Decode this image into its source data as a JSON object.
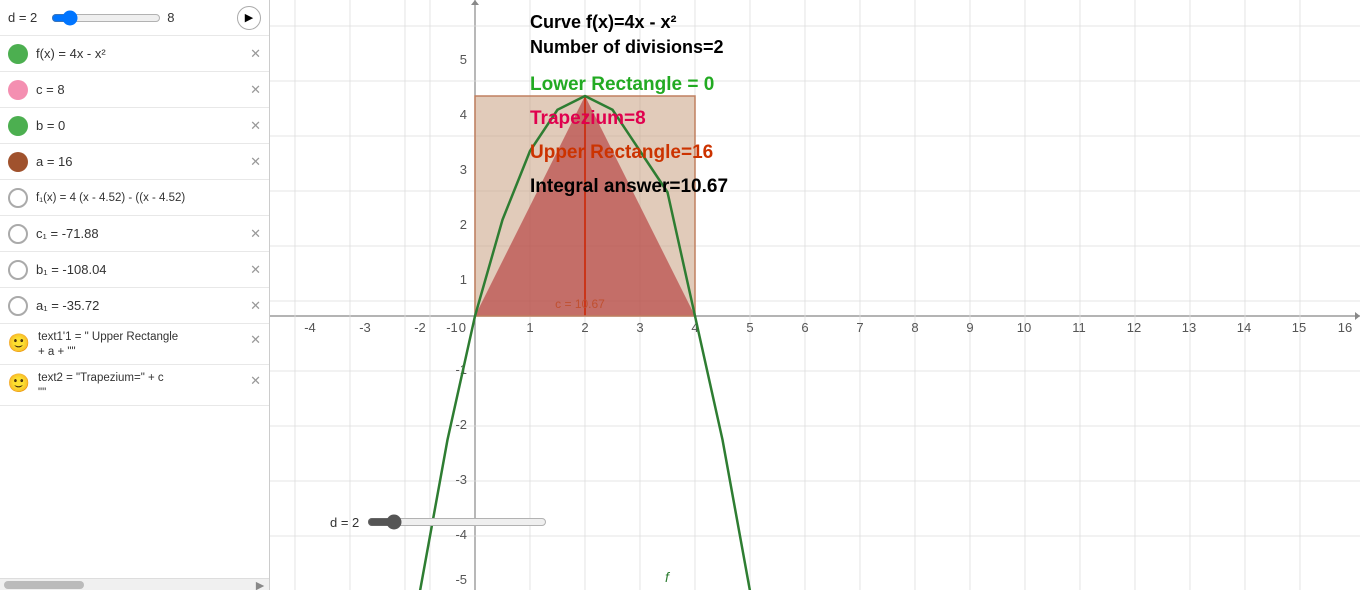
{
  "left_panel": {
    "slider": {
      "label": "d = 2",
      "value": 2,
      "min": 1,
      "max": 10,
      "display_val": "2",
      "right_val": "8"
    },
    "items": [
      {
        "id": "fx",
        "dot_color": "#4caf50",
        "dot_type": "filled",
        "label": "f(x) = 4x - x²",
        "has_close": true
      },
      {
        "id": "c",
        "dot_color": "#f48fb1",
        "dot_type": "filled",
        "label": "c = 8",
        "has_close": true
      },
      {
        "id": "b",
        "dot_color": "#4caf50",
        "dot_type": "filled",
        "label": "b = 0",
        "has_close": true
      },
      {
        "id": "a",
        "dot_color": "#a0522d",
        "dot_type": "filled",
        "label": "a = 16",
        "has_close": true
      },
      {
        "id": "f1x",
        "dot_color": "",
        "dot_type": "outline",
        "label": "f₁(x) = 4 (x - 4.52) - ((x - 4.52)",
        "has_close": false
      },
      {
        "id": "c1",
        "dot_color": "",
        "dot_type": "outline",
        "label": "c₁ = -71.88",
        "has_close": true
      },
      {
        "id": "b1",
        "dot_color": "",
        "dot_type": "outline",
        "label": "b₁ = -108.04",
        "has_close": true
      },
      {
        "id": "a1",
        "dot_color": "",
        "dot_type": "outline",
        "label": "a₁ = -35.72",
        "has_close": true
      },
      {
        "id": "text1",
        "dot_color": "emoji",
        "dot_type": "emoji",
        "emoji": "😊",
        "label": "text1'1 = \" Upper Rectangle\n+ a + \"\"",
        "has_close": true
      },
      {
        "id": "text2",
        "dot_color": "emoji2",
        "dot_type": "emoji",
        "emoji": "😊",
        "label": "text2 = \"Trapezium=\" + c\n\"\"",
        "has_close": true
      }
    ]
  },
  "graph": {
    "curve_title": "Curve f(x)=4x - x²",
    "divisions_label": "Number of divisions=2",
    "lower_rect_label": "Lower Rectangle = 0",
    "trapezium_label": "Trapezium=8",
    "upper_rect_label": "Upper Rectangle=16",
    "integral_label": "Integral answer=10.67",
    "c_label": "c = 10.67",
    "d_label": "d = 2"
  },
  "colors": {
    "lower_rect": "#22aa22",
    "trapezium": "#e0004e",
    "upper_rect": "#cc3300",
    "integral": "#000000",
    "curve": "#2e7d32",
    "upper_fill": "#c8a090",
    "lower_fill": "#c0504040",
    "trapezium_fill": "#c85060"
  }
}
